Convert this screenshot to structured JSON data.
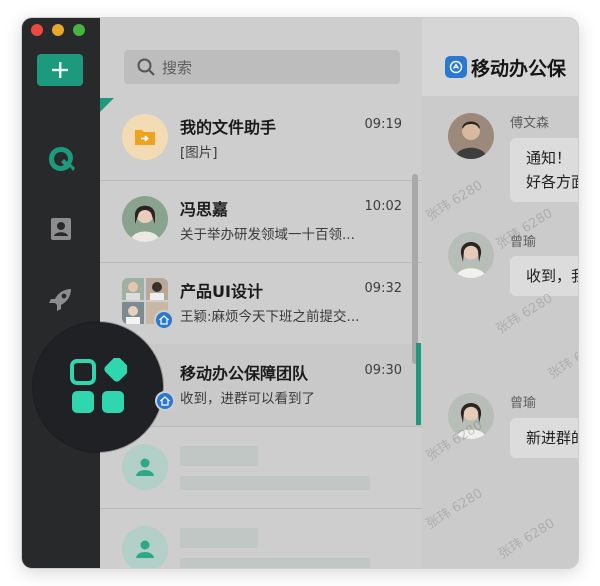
{
  "search": {
    "placeholder": "搜索"
  },
  "conversations": [
    {
      "name": "我的文件助手",
      "time": "09:19",
      "preview": "[图片]"
    },
    {
      "name": "冯思嘉",
      "time": "10:02",
      "preview": "关于举办研发领域一十百领..."
    },
    {
      "name": "产品UI设计",
      "time": "09:32",
      "preview": "王颖:麻烦今天下班之前提交..."
    },
    {
      "name": "移动办公保障团队",
      "time": "09:30",
      "preview": "收到，进群可以看到了"
    }
  ],
  "chat": {
    "title": "移动办公保",
    "messages": [
      {
        "sender": "傅文森",
        "lines": [
          "通知！",
          "好各方面"
        ]
      },
      {
        "sender": "曾瑜",
        "lines": [
          "收到，我"
        ]
      },
      {
        "sender": "曾瑜",
        "lines": [
          "新进群的"
        ]
      }
    ]
  },
  "watermark": {
    "text": "张玮 6280"
  },
  "colors": {
    "accent": "#1d9a7e",
    "nav_bg": "#28292b",
    "badge_blue": "#2a78d2"
  },
  "icons": {
    "compose": "plus-icon",
    "nav": [
      "logo-icon",
      "contacts-icon",
      "rocket-icon"
    ],
    "apps": "apps-grid-icon"
  }
}
